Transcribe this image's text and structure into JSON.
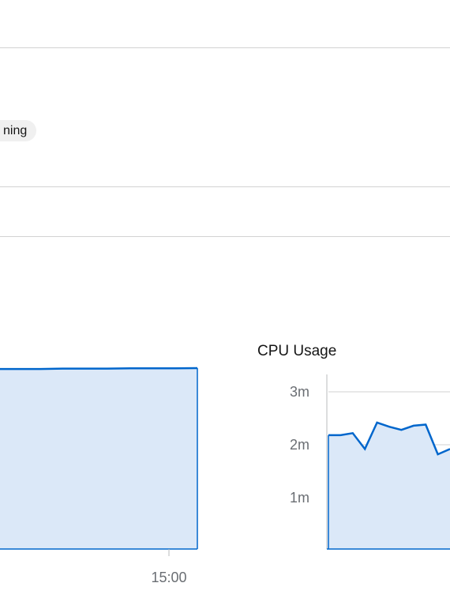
{
  "pod_status": {
    "label": "Running",
    "visible_text": "ning"
  },
  "colors": {
    "series_line": "#0066cc",
    "series_fill": "#dbe8f8",
    "grid": "#d2d2d2",
    "axis": "#b8bbbe",
    "tick_text": "#6a6e73",
    "divider": "#d2d2d2",
    "pill_bg": "#f0f0f0"
  },
  "chart_data": [
    {
      "type": "area",
      "title": "",
      "x_tick_labels": [
        "15:00"
      ],
      "y_tick_labels": [],
      "series": [
        {
          "values": [
            0.86,
            0.86,
            0.86,
            0.862,
            0.862,
            0.862,
            0.863,
            0.863,
            0.863,
            0.864
          ]
        }
      ],
      "ylim": [
        0,
        1
      ],
      "grid": true,
      "legend": "none"
    },
    {
      "type": "area",
      "title": "CPU Usage",
      "y_tick_labels": [
        "3m",
        "2m",
        "1m"
      ],
      "y_ticks": [
        3,
        2,
        1
      ],
      "ylabel": "",
      "xlabel": "",
      "series": [
        {
          "values": [
            2.18,
            2.18,
            2.22,
            1.92,
            2.42,
            2.34,
            2.28,
            2.36,
            2.38,
            1.82,
            1.92
          ]
        }
      ],
      "ylim": [
        0,
        3.3
      ],
      "grid": true,
      "legend": "none"
    }
  ]
}
